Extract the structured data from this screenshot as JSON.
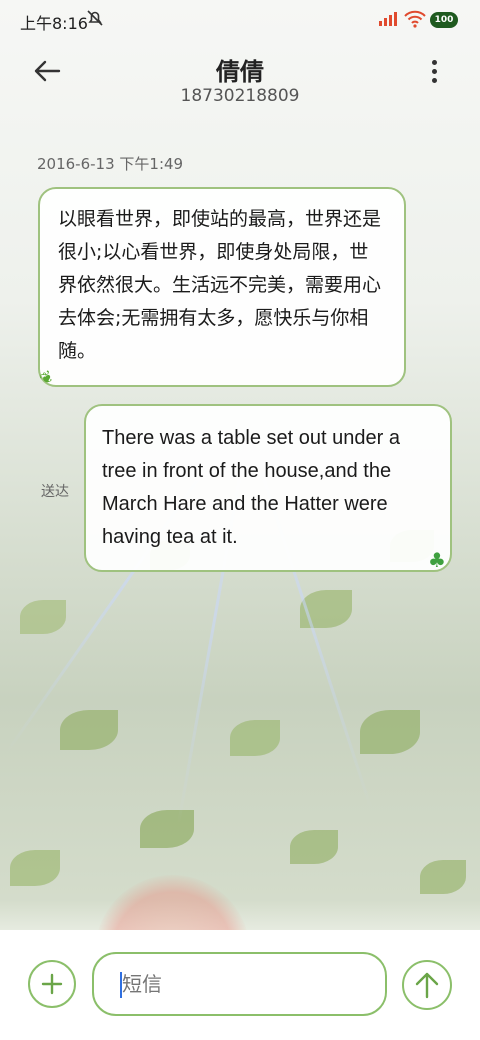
{
  "status_bar": {
    "time": "上午8:16",
    "battery_level": "100"
  },
  "header": {
    "contact_name": "倩倩",
    "phone_number": "18730218809"
  },
  "conversation": {
    "timestamp": "2016-6-13 下午1:49",
    "incoming_message": "以眼看世界，即使站的最高，世界还是很小;以心看世界，即使身处局限，世界依然很大。生活远不完美，需要用心去体会;无需拥有太多，愿快乐与你相随。",
    "outgoing_message": "There was a table set out under a tree in front of the house,and the March Hare and the Hatter were having tea at it.",
    "outgoing_status": "送达"
  },
  "composer": {
    "placeholder": "短信"
  },
  "colors": {
    "accent_green": "#8bbf6a",
    "signal_red": "#e04a2e",
    "battery_green": "#1f5a1f"
  },
  "icons": {
    "back": "arrow-left-icon",
    "more": "more-vertical-icon",
    "add": "plus-icon",
    "send": "arrow-up-icon",
    "mute": "bell-off-icon",
    "signal": "signal-icon",
    "wifi": "wifi-icon",
    "battery": "battery-icon"
  }
}
